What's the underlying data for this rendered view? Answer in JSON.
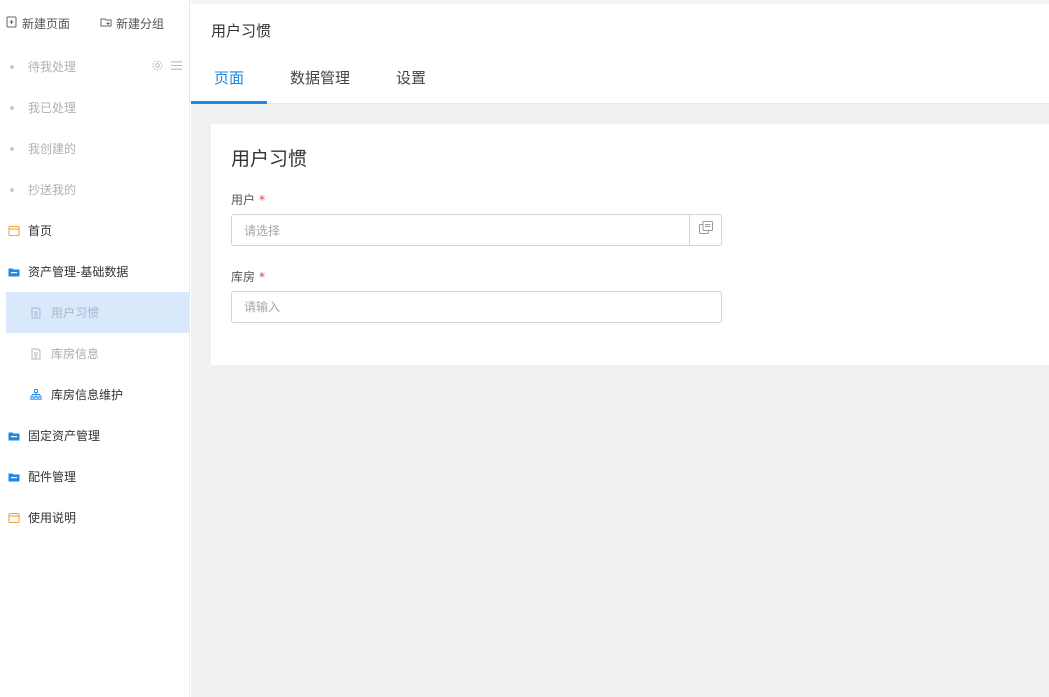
{
  "sidebar": {
    "actions": {
      "new_page": "新建页面",
      "new_group": "新建分组"
    },
    "items": [
      {
        "label": "待我处理",
        "kind": "dot"
      },
      {
        "label": "我已处理",
        "kind": "dot"
      },
      {
        "label": "我创建的",
        "kind": "dot"
      },
      {
        "label": "抄送我的",
        "kind": "dot"
      },
      {
        "label": "首页",
        "kind": "page",
        "icon": "page-icon"
      },
      {
        "label": "资产管理-基础数据",
        "kind": "folder-open",
        "icon": "folder-open-icon"
      },
      {
        "label": "用户习惯",
        "kind": "child-active",
        "icon": "file-icon"
      },
      {
        "label": "库房信息",
        "kind": "child-muted",
        "icon": "file-icon"
      },
      {
        "label": "库房信息维护",
        "kind": "child",
        "icon": "org-chart-icon"
      },
      {
        "label": "固定资产管理",
        "kind": "folder",
        "icon": "folder-icon"
      },
      {
        "label": "配件管理",
        "kind": "folder",
        "icon": "folder-icon"
      },
      {
        "label": "使用说明",
        "kind": "page",
        "icon": "page-icon"
      }
    ]
  },
  "header": {
    "title": "用户习惯",
    "tabs": [
      {
        "label": "页面",
        "active": true
      },
      {
        "label": "数据管理",
        "active": false
      },
      {
        "label": "设置",
        "active": false
      }
    ]
  },
  "form": {
    "title": "用户习惯",
    "user": {
      "label": "用户",
      "required_mark": "*",
      "placeholder": "请选择"
    },
    "warehouse": {
      "label": "库房",
      "required_mark": "*",
      "placeholder": "请输入"
    }
  },
  "colors": {
    "accent": "#1e88e5",
    "active_bg": "#d9e8fb",
    "folder": "#1e88e5",
    "page_icon": "#f0a33a",
    "required": "#e53935"
  }
}
